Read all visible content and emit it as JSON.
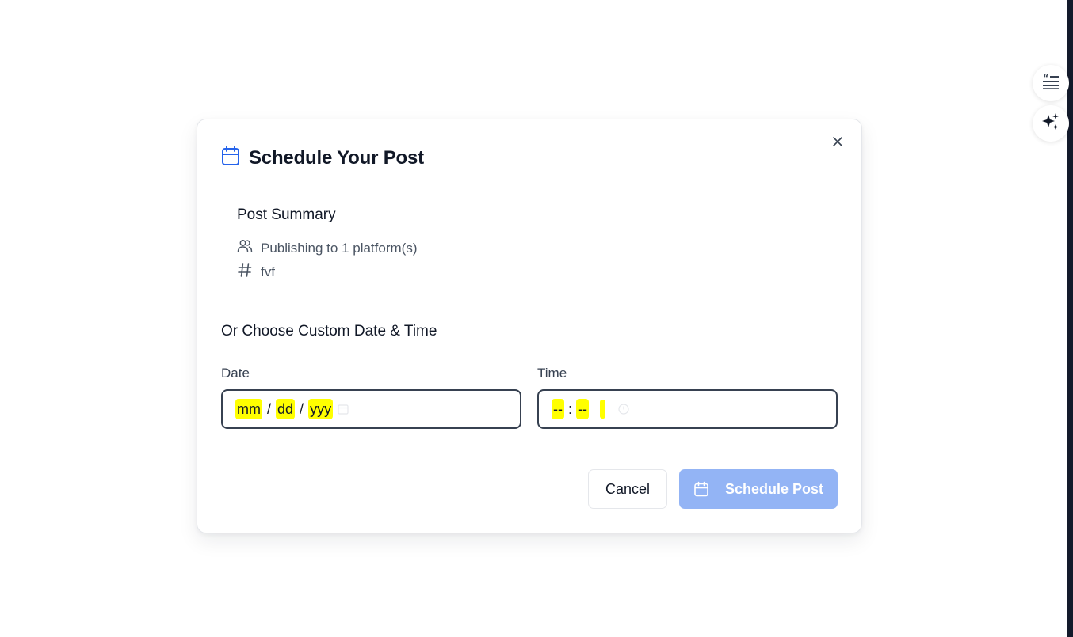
{
  "colors": {
    "accent": "#2563eb",
    "schedule_button_disabled": "#93b4f5",
    "segment_highlight": "#ffff00",
    "edge_strip": "#131a2b"
  },
  "side_fabs": [
    {
      "icon": "quote-lines-icon"
    },
    {
      "icon": "sparkles-icon"
    }
  ],
  "modal": {
    "title": "Schedule Your Post",
    "title_icon": "calendar-icon",
    "close_icon": "close-icon",
    "summary": {
      "title": "Post Summary",
      "platforms_icon": "users-icon",
      "platforms_text": "Publishing to 1 platform(s)",
      "tag_icon": "hash-icon",
      "tag_text": "fvf"
    },
    "custom": {
      "title": "Or Choose Custom Date & Time",
      "date_label": "Date",
      "date_segments": {
        "month": "mm",
        "day": "dd",
        "year": "yyy",
        "sep": "/"
      },
      "time_label": "Time",
      "time_segments": {
        "hour": "--",
        "minute": "--",
        "sep": ":"
      }
    },
    "buttons": {
      "cancel": "Cancel",
      "schedule": "Schedule Post"
    }
  }
}
